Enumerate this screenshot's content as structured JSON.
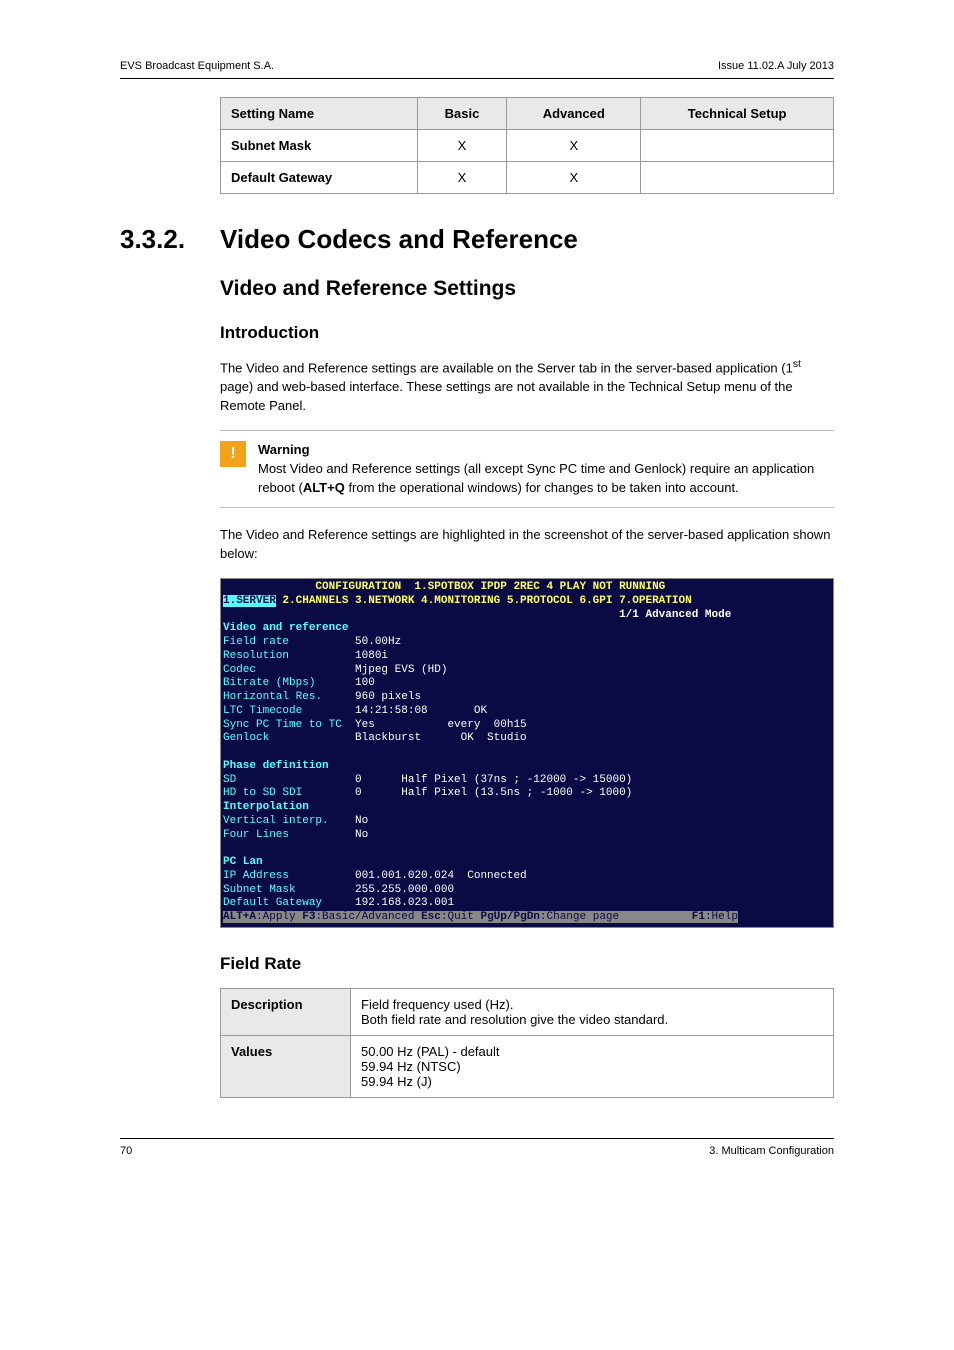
{
  "header": {
    "left": "EVS Broadcast Equipment S.A.",
    "right": "Issue 11.02.A July 2013"
  },
  "modes_table": {
    "headers": [
      "Setting Name",
      "Basic",
      "Advanced",
      "Technical Setup"
    ],
    "rows": [
      {
        "name": "Subnet Mask",
        "basic": "X",
        "advanced": "X",
        "tech": ""
      },
      {
        "name": "Default Gateway",
        "basic": "X",
        "advanced": "X",
        "tech": ""
      }
    ]
  },
  "section": {
    "number": "3.3.2.",
    "title": "Video Codecs and Reference"
  },
  "subhead": "Video and Reference Settings",
  "intro": {
    "heading": "Introduction",
    "p1a": "The Video and Reference settings are available on the Server tab in the server-based application (1",
    "p1sup": "st",
    "p1b": " page) and web-based interface. These settings are not available in the Technical Setup menu of the Remote Panel."
  },
  "warning": {
    "title": "Warning",
    "text_a": "Most Video and Reference settings (all except Sync PC time and Genlock) require an application reboot (",
    "alt": "ALT+Q",
    "text_b": " from the operational windows) for changes to be taken into account."
  },
  "screenshot_intro": "The Video and Reference settings are highlighted in the screenshot of the server-based application shown below:",
  "terminal": {
    "title_l": "CONFIGURATION",
    "title_r": "1.SPOTBOX IPDP 2REC 4 PLAY NOT RUNNING",
    "tabs_active": "1.SERVER",
    "tabs_rest": " 2.CHANNELS 3.NETWORK 4.MONITORING 5.PROTOCOL 6.GPI 7.OPERATION",
    "mode": "1/1 Advanced Mode",
    "section1": "Video and reference",
    "rows1": [
      [
        "Field rate",
        "50.00Hz"
      ],
      [
        "Resolution",
        "1080i"
      ],
      [
        "Codec",
        "Mjpeg EVS (HD)"
      ],
      [
        "Bitrate (Mbps)",
        "100"
      ],
      [
        "Horizontal Res.",
        "960 pixels"
      ],
      [
        "LTC Timecode",
        "14:21:58:08       OK"
      ],
      [
        "Sync PC Time to TC",
        "Yes           every  00h15"
      ],
      [
        "Genlock",
        "Blackburst      OK  Studio"
      ]
    ],
    "section2": "Phase definition",
    "rows2": [
      [
        "SD",
        "0      Half Pixel (37ns ; -12000 -> 15000)"
      ],
      [
        "HD to SD SDI",
        "0      Half Pixel (13.5ns ; -1000 -> 1000)"
      ]
    ],
    "section2b": "Interpolation",
    "rows2b": [
      [
        "Vertical interp.",
        "No"
      ],
      [
        "Four Lines",
        "No"
      ]
    ],
    "section3": "PC Lan",
    "rows3": [
      [
        "IP Address",
        "001.001.020.024  Connected"
      ],
      [
        "Subnet Mask",
        "255.255.000.000"
      ],
      [
        "Default Gateway",
        "192.168.023.001"
      ]
    ],
    "footer_keys": {
      "k1": "ALT+A",
      "k1t": ":Apply ",
      "k2": "F3",
      "k2t": ":Basic/Advanced ",
      "k3": "Esc",
      "k3t": ":Quit ",
      "k4": "PgUp/PgDn",
      "k4t": ":Change page",
      "k5": "F1",
      "k5t": ":Help"
    }
  },
  "field_rate": {
    "heading": "Field Rate",
    "desc_label": "Description",
    "desc_val": "Field frequency used (Hz).\nBoth field rate and resolution give the video standard.",
    "val_label": "Values",
    "val_val": "50.00 Hz (PAL) - default\n59.94 Hz (NTSC)\n59.94 Hz (J)"
  },
  "footer": {
    "left": "70",
    "right": "3. Multicam Configuration"
  }
}
